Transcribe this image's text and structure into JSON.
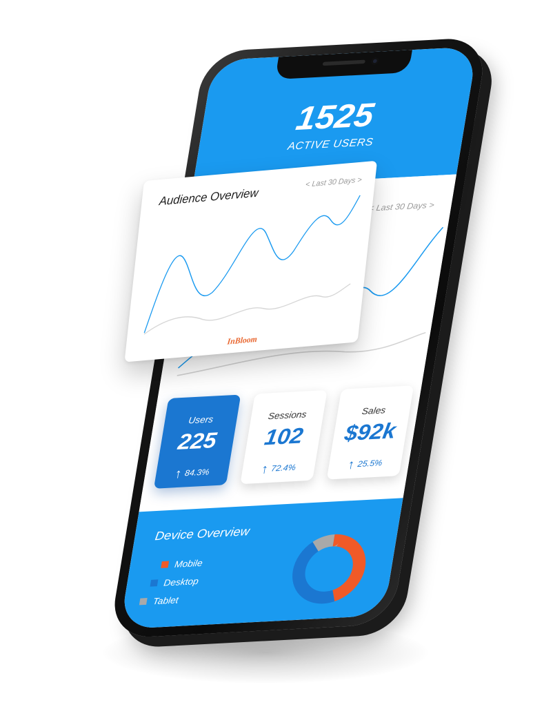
{
  "header": {
    "active_count": "1525",
    "active_label": "ACTIVE USERS"
  },
  "overview": {
    "title": "Audience Overview",
    "range": "< Last 30 Days >",
    "brand": "InBloom",
    "under_range": "< Last 30 Days >"
  },
  "stats": [
    {
      "label": "Users",
      "value": "225",
      "change": "84.3%"
    },
    {
      "label": "Sessions",
      "value": "102",
      "change": "72.4%"
    },
    {
      "label": "Sales",
      "value": "$92k",
      "change": "25.5%"
    }
  ],
  "device": {
    "title": "Device Overview",
    "legend": [
      {
        "label": "Mobile",
        "color": "#f05a28"
      },
      {
        "label": "Desktop",
        "color": "#1b77d1"
      },
      {
        "label": "Tablet",
        "color": "#a9a9a9"
      }
    ],
    "shares": [
      {
        "name": "Mobile",
        "value": 45
      },
      {
        "name": "Desktop",
        "value": 45
      },
      {
        "name": "Tablet",
        "value": 10
      }
    ]
  },
  "colors": {
    "accent": "#1a9af0",
    "card_blue": "#1b77d1",
    "mobile": "#f05a28",
    "desktop": "#1b77d1",
    "tablet": "#a9a9a9"
  },
  "icons": {
    "trend": "arrow-up-icon"
  }
}
